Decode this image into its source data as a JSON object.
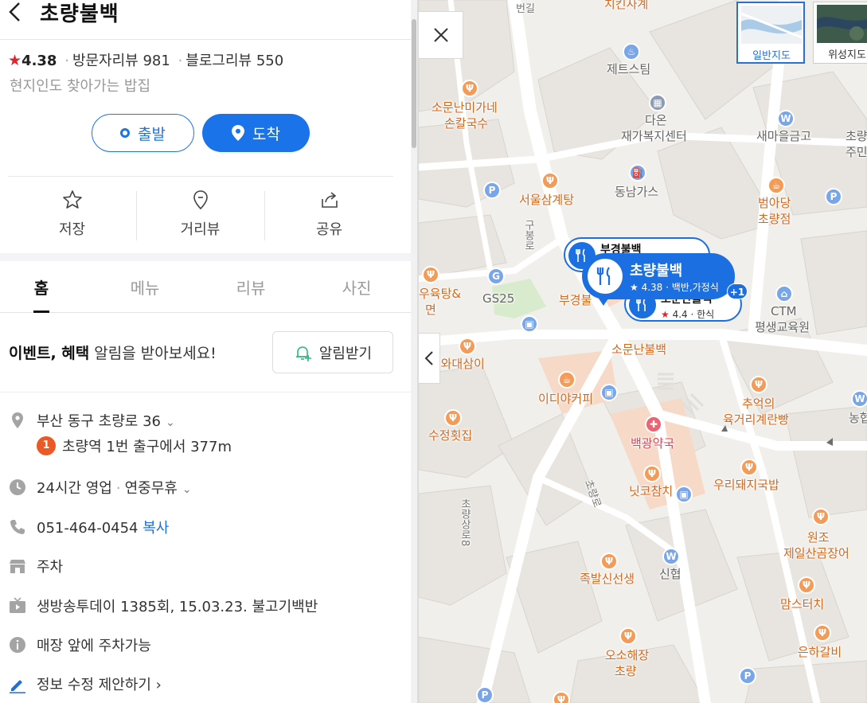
{
  "place": {
    "name": "초량불백",
    "rating_star": "★",
    "rating": "4.38",
    "visitor_reviews": "방문자리뷰 981",
    "blog_reviews": "블로그리뷰 550",
    "separator": "·",
    "description": "현지인도 찾아가는 밥집"
  },
  "buttons": {
    "start": "출발",
    "arrive": "도착"
  },
  "actions": [
    {
      "label": "저장",
      "icon": "star-outline-icon"
    },
    {
      "label": "거리뷰",
      "icon": "location-marker-outline-icon"
    },
    {
      "label": "공유",
      "icon": "share-icon"
    }
  ],
  "tabs": [
    {
      "label": "홈",
      "active": true
    },
    {
      "label": "메뉴",
      "active": false
    },
    {
      "label": "리뷰",
      "active": false
    },
    {
      "label": "사진",
      "active": false
    }
  ],
  "event": {
    "bold": "이벤트, 혜택",
    "text": " 알림을 받아보세요!",
    "button": "알림받기"
  },
  "info": {
    "address": "부산 동구 초량로 36",
    "subway_line": "1",
    "subway_text": "초량역 1번 출구에서 377m",
    "hours": "24시간 영업",
    "hours_extra": "연중무휴",
    "phone": "051-464-0454",
    "copy": "복사",
    "parking": "주차",
    "tv": "생방송투데이 1385회, 15.03.23. 불고기백반",
    "note": "매장 앞에 주차가능",
    "edit": "정보 수정 제안하기 ›"
  },
  "map": {
    "map_types": [
      {
        "label": "일반지도",
        "active": true
      },
      {
        "label": "위성지도",
        "active": false
      }
    ],
    "pins": {
      "main": {
        "name": "초량불백",
        "meta": "★ 4.38 · 백반,가정식"
      },
      "sub1": {
        "name": "부경불백"
      },
      "sub2": {
        "name": "소문난불백",
        "star": "★",
        "meta": " 4.4 · 한식"
      },
      "more": "+1"
    },
    "labels": {
      "l1": "치킨사계",
      "l2": "제트스팀",
      "l3": "소문난미가네",
      "l4": "손칼국수",
      "l5": "다온",
      "l6": "재가복지센터",
      "l7": "새마을금고",
      "l8": "초량",
      "l9": "주민",
      "l10": "서울삼계탕",
      "l11": "동남가스",
      "l12": "범아당",
      "l13": "초량점",
      "l14": "구봉로",
      "l15": "GS25",
      "l16": "부경불",
      "l17": "우육탕&",
      "l18": "면",
      "l19": "CTM",
      "l20": "평생교육원",
      "l21": "소문난불백",
      "l22": "삼이와대삼이",
      "l23": "이디야커피",
      "l24": "추억의",
      "l25": "육거리계란빵",
      "l26": "수정횟집",
      "l27": "백광약국",
      "l28": "닛코참치",
      "l29": "우리돼지국밥",
      "l30": "초량로",
      "l31": "초량상로8",
      "l32": "원조",
      "l33": "제일산곰장어",
      "l34": "신협",
      "l35": "족발신선생",
      "l36": "맘스터치",
      "l37": "오소해장",
      "l38": "초량",
      "l39": "은하갈비",
      "l40": "농협",
      "l41": "번길"
    }
  }
}
